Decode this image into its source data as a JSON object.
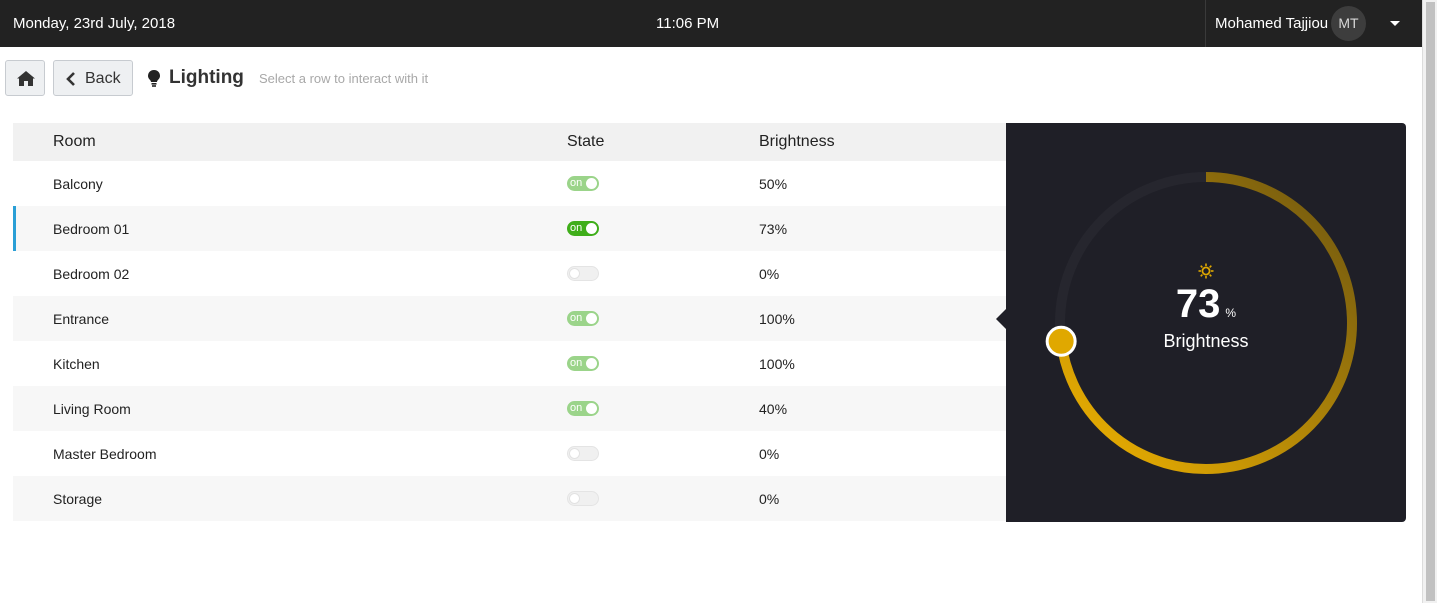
{
  "topbar": {
    "date": "Monday, 23rd July, 2018",
    "time": "11:06 PM",
    "user_name": "Mohamed Tajjiou",
    "user_initials": "MT"
  },
  "toolbar": {
    "home_icon": "home-icon",
    "back_label": "Back",
    "title": "Lighting",
    "title_icon": "lightbulb-icon",
    "hint": "Select a row to interact with it"
  },
  "table": {
    "headers": {
      "room": "Room",
      "state": "State",
      "brightness": "Brightness"
    },
    "on_text": "on",
    "rows": [
      {
        "room": "Balcony",
        "on": true,
        "brightness": "50%"
      },
      {
        "room": "Bedroom 01",
        "on": true,
        "brightness": "73%",
        "selected": true
      },
      {
        "room": "Bedroom 02",
        "on": false,
        "brightness": "0%"
      },
      {
        "room": "Entrance",
        "on": true,
        "brightness": "100%"
      },
      {
        "room": "Kitchen",
        "on": true,
        "brightness": "100%"
      },
      {
        "room": "Living Room",
        "on": true,
        "brightness": "40%"
      },
      {
        "room": "Master Bedroom",
        "on": false,
        "brightness": "0%"
      },
      {
        "room": "Storage",
        "on": false,
        "brightness": "0%"
      }
    ]
  },
  "dial": {
    "value": "73",
    "unit": "%",
    "label": "Brightness",
    "level": 0.73,
    "icon": "sun-icon",
    "accent": "#e0a800"
  },
  "colors": {
    "topbar": "#222222",
    "selected_row": "#2a9fd6",
    "toggle_on": "#9bd48a",
    "toggle_on_selected": "#3fae1a",
    "panel": "#1f1f27"
  }
}
